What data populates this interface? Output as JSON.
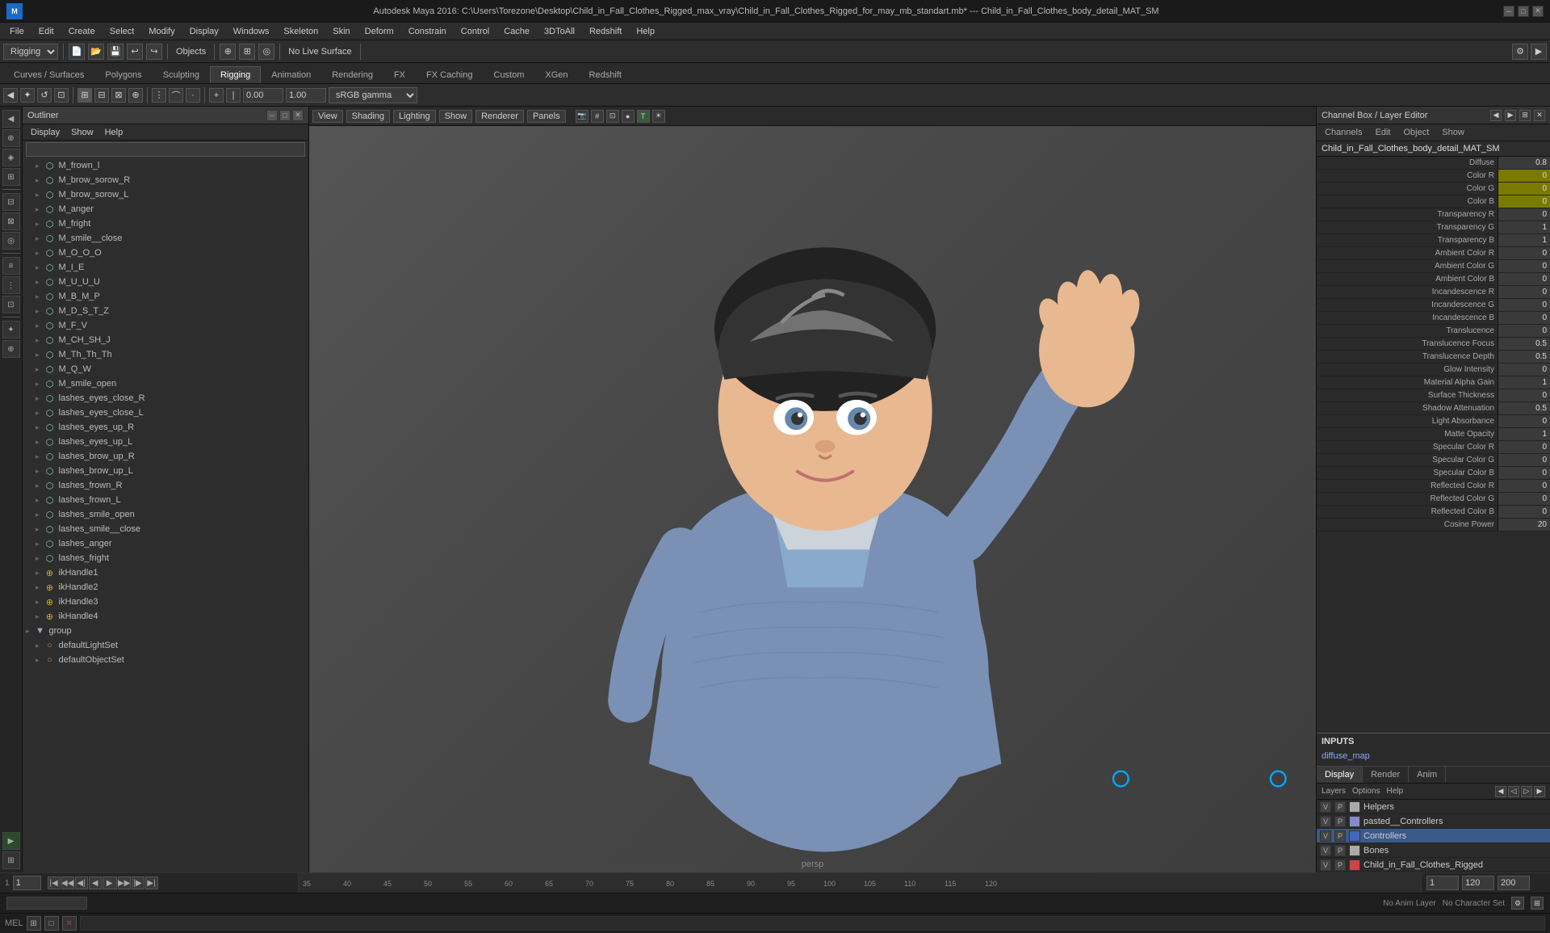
{
  "title": "Autodesk Maya 2016: C:\\Users\\Torezone\\Desktop\\Child_in_Fall_Clothes_Rigged_max_vray\\Child_in_Fall_Clothes_Rigged_for_may_mb_standart.mb* --- Child_in_Fall_Clothes_body_detail_MAT_SM",
  "menu": {
    "items": [
      "File",
      "Edit",
      "Create",
      "Select",
      "Modify",
      "Display",
      "Windows",
      "Skeleton",
      "Skin",
      "Deform",
      "Constrain",
      "Control",
      "Cache",
      "3DToAll",
      "Redshift",
      "Help"
    ]
  },
  "toolbar": {
    "mode_select": "Rigging",
    "objects_label": "Objects",
    "live_surface": "No Live Surface",
    "coordinates": [
      "0.00",
      "1.00"
    ],
    "color_space": "sRGB gamma"
  },
  "main_tabs": {
    "items": [
      "Curves / Surfaces",
      "Polygons",
      "Sculpting",
      "Rigging",
      "Animation",
      "Rendering",
      "FX",
      "FX Caching",
      "Custom",
      "XGen",
      "Redshift"
    ],
    "active": "Rigging"
  },
  "viewport_menu": {
    "items": [
      "View",
      "Shading",
      "Lighting",
      "Show",
      "Renderer",
      "Panels"
    ]
  },
  "outliner": {
    "title": "Outliner",
    "menu_items": [
      "Display",
      "Help",
      "Help"
    ],
    "items": [
      {
        "name": "M_frown_l",
        "type": "mesh",
        "indent": 0
      },
      {
        "name": "M_brow_sorow_R",
        "type": "mesh",
        "indent": 0
      },
      {
        "name": "M_brow_sorow_L",
        "type": "mesh",
        "indent": 0
      },
      {
        "name": "M_anger",
        "type": "mesh",
        "indent": 0
      },
      {
        "name": "M_fright",
        "type": "mesh",
        "indent": 0
      },
      {
        "name": "M_smile__close",
        "type": "mesh",
        "indent": 0
      },
      {
        "name": "M_O_O_O",
        "type": "mesh",
        "indent": 0
      },
      {
        "name": "M_I_E",
        "type": "mesh",
        "indent": 0
      },
      {
        "name": "M_U_U_U",
        "type": "mesh",
        "indent": 0
      },
      {
        "name": "M_B_M_P",
        "type": "mesh",
        "indent": 0
      },
      {
        "name": "M_D_S_T_Z",
        "type": "mesh",
        "indent": 0
      },
      {
        "name": "M_F_V",
        "type": "mesh",
        "indent": 0
      },
      {
        "name": "M_CH_SH_J",
        "type": "mesh",
        "indent": 0
      },
      {
        "name": "M_Th_Th_Th",
        "type": "mesh",
        "indent": 0
      },
      {
        "name": "M_Q_W",
        "type": "mesh",
        "indent": 0
      },
      {
        "name": "M_smile_open",
        "type": "mesh",
        "indent": 0
      },
      {
        "name": "lashes_eyes_close_R",
        "type": "mesh",
        "indent": 0
      },
      {
        "name": "lashes_eyes_close_L",
        "type": "mesh",
        "indent": 0
      },
      {
        "name": "lashes_eyes_up_R",
        "type": "mesh",
        "indent": 0
      },
      {
        "name": "lashes_eyes_up_L",
        "type": "mesh",
        "indent": 0
      },
      {
        "name": "lashes_brow_up_R",
        "type": "mesh",
        "indent": 0
      },
      {
        "name": "lashes_brow_up_L",
        "type": "mesh",
        "indent": 0
      },
      {
        "name": "lashes_frown_R",
        "type": "mesh",
        "indent": 0
      },
      {
        "name": "lashes_frown_L",
        "type": "mesh",
        "indent": 0
      },
      {
        "name": "lashes_smile_open",
        "type": "mesh",
        "indent": 0
      },
      {
        "name": "lashes_smile__close",
        "type": "mesh",
        "indent": 0
      },
      {
        "name": "lashes_anger",
        "type": "mesh",
        "indent": 0
      },
      {
        "name": "lashes_fright",
        "type": "mesh",
        "indent": 0
      },
      {
        "name": "ikHandle1",
        "type": "handle",
        "indent": 0
      },
      {
        "name": "ikHandle2",
        "type": "handle",
        "indent": 0
      },
      {
        "name": "ikHandle3",
        "type": "handle",
        "indent": 0
      },
      {
        "name": "ikHandle4",
        "type": "handle",
        "indent": 0
      },
      {
        "name": "group",
        "type": "group",
        "indent": 0,
        "expanded": true
      },
      {
        "name": "defaultLightSet",
        "type": "set",
        "indent": 0
      },
      {
        "name": "defaultObjectSet",
        "type": "set",
        "indent": 0
      }
    ]
  },
  "channel_box": {
    "header": "Channel Box / Layer Editor",
    "tabs": [
      "Channels",
      "Edit",
      "Object",
      "Show"
    ],
    "object_name": "Child_in_Fall_Clothes_body_detail_MAT_SM",
    "channels": [
      {
        "name": "Diffuse",
        "value": "0.8",
        "style": "normal"
      },
      {
        "name": "Color R",
        "value": "0",
        "style": "yellow"
      },
      {
        "name": "Color G",
        "value": "0",
        "style": "yellow"
      },
      {
        "name": "Color B",
        "value": "0",
        "style": "yellow"
      },
      {
        "name": "Transparency R",
        "value": "0",
        "style": "normal"
      },
      {
        "name": "Transparency G",
        "value": "1",
        "style": "normal"
      },
      {
        "name": "Transparency B",
        "value": "1",
        "style": "normal"
      },
      {
        "name": "Ambient Color R",
        "value": "0",
        "style": "normal"
      },
      {
        "name": "Ambient Color G",
        "value": "0",
        "style": "normal"
      },
      {
        "name": "Ambient Color B",
        "value": "0",
        "style": "normal"
      },
      {
        "name": "Incandescence R",
        "value": "0",
        "style": "normal"
      },
      {
        "name": "Incandescence G",
        "value": "0",
        "style": "normal"
      },
      {
        "name": "Incandescence B",
        "value": "0",
        "style": "normal"
      },
      {
        "name": "Translucence",
        "value": "0",
        "style": "normal"
      },
      {
        "name": "Translucence Focus",
        "value": "0.5",
        "style": "normal"
      },
      {
        "name": "Translucence Depth",
        "value": "0.5",
        "style": "normal"
      },
      {
        "name": "Glow Intensity",
        "value": "0",
        "style": "normal"
      },
      {
        "name": "Material Alpha Gain",
        "value": "1",
        "style": "normal"
      },
      {
        "name": "Surface Thickness",
        "value": "0",
        "style": "normal"
      },
      {
        "name": "Shadow Attenuation",
        "value": "0.5",
        "style": "normal"
      },
      {
        "name": "Light Absorbance",
        "value": "0",
        "style": "normal"
      },
      {
        "name": "Matte Opacity",
        "value": "1",
        "style": "normal"
      },
      {
        "name": "Specular Color R",
        "value": "0",
        "style": "normal"
      },
      {
        "name": "Specular Color G",
        "value": "0",
        "style": "normal"
      },
      {
        "name": "Specular Color B",
        "value": "0",
        "style": "normal"
      },
      {
        "name": "Reflected Color R",
        "value": "0",
        "style": "normal"
      },
      {
        "name": "Reflected Color G",
        "value": "0",
        "style": "normal"
      },
      {
        "name": "Reflected Color B",
        "value": "0",
        "style": "normal"
      },
      {
        "name": "Cosine Power",
        "value": "20",
        "style": "normal"
      }
    ],
    "inputs_label": "INPUTS",
    "inputs": [
      "diffuse_map"
    ]
  },
  "layer_editor": {
    "tabs": [
      "Display",
      "Render",
      "Anim"
    ],
    "active_tab": "Display",
    "option_tabs": [
      "Layers",
      "Options",
      "Help"
    ],
    "layers": [
      {
        "name": "Helpers",
        "v": "V",
        "p": "P",
        "color": "#aaaaaa"
      },
      {
        "name": "pasted__Controllers",
        "v": "V",
        "p": "P",
        "color": "#8888cc"
      },
      {
        "name": "Controllers",
        "v": "V",
        "p": "P",
        "color": "#4466bb",
        "selected": true
      },
      {
        "name": "Bones",
        "v": "V",
        "p": "P",
        "color": "#aaaaaa"
      },
      {
        "name": "Child_in_Fall_Clothes_Rigged",
        "v": "V",
        "p": "P",
        "color": "#cc4444"
      }
    ]
  },
  "timeline": {
    "start_frame": "1",
    "end_frame": "120",
    "current_frame": "1",
    "range_start": "1",
    "range_end": "120",
    "playback_end": "200",
    "ticks": [
      "35",
      "40",
      "45",
      "50",
      "55",
      "60",
      "65",
      "70",
      "75",
      "80",
      "85",
      "90",
      "95",
      "100",
      "105",
      "110",
      "115",
      "120"
    ],
    "anim_layer": "No Anim Layer",
    "no_char_set": "No Character Set",
    "persp_label": "persp"
  },
  "mel": {
    "label": "MEL"
  },
  "status_bar": {
    "items": []
  }
}
